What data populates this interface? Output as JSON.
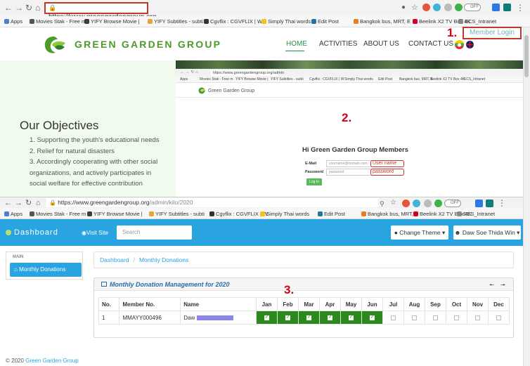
{
  "browser_top": {
    "url": "https://www.greengardengroup.org",
    "off_label": "OFF",
    "bookmarks": [
      {
        "label": "Apps",
        "color": "#4a7fd4"
      },
      {
        "label": "Movies Stak - Free m",
        "color": "#555555"
      },
      {
        "label": "YIFY Browse Movie |",
        "color": "#3c3c3c"
      },
      {
        "label": "YIFY Subtitles - subti",
        "color": "#e8a33d"
      },
      {
        "label": "Cgvflix : CGVFLIX | W",
        "color": "#333333"
      },
      {
        "label": "Simply Thai words",
        "color": "#f0c419"
      },
      {
        "label": "Edit Post",
        "color": "#21759b"
      },
      {
        "label": "Bangkok bus, MRT, E",
        "color": "#e67e22"
      },
      {
        "label": "Beelink X2 TV Box 4K",
        "color": "#d0021b"
      },
      {
        "label": "ECS_Intranet",
        "color": "#888888"
      }
    ]
  },
  "site": {
    "logo_text": "GREEN GARDEN GROUP",
    "menu": [
      "HOME",
      "ACTIVITIES",
      "ABOUT US",
      "CONTACT US"
    ],
    "member_login": "Member Login",
    "objectives_title": "Our Objectives",
    "objectives": [
      "1. Supporting the youth's educational needs",
      "2. Relief for natural disasters",
      "3. Accordingly cooperating with other social",
      "organizations, and actively participates in",
      "social welfare for effective contribution"
    ]
  },
  "steps": {
    "one": "1.",
    "two": "2.",
    "three": "3."
  },
  "login_shot": {
    "url": "https://www.greengardengroup.org/admin",
    "bookmarks": [
      "Apps",
      "Movies Stak - Free m",
      "YIFY Browse Movie |",
      "YIFY Subtitles - subti",
      "Cgvflix : CGVFLIX | W",
      "Simply Thai words",
      "Edit Post",
      "Bangkok bus, MRT, E",
      "Beelink X2 TV Box 4K",
      "ECS_Intranet"
    ],
    "logo_text": "Green Garden Group",
    "title": "Hi Green Garden Group Members",
    "email_label": "E-Mail",
    "email_placeholder": "yourname@domain.com",
    "password_label": "Password",
    "password_placeholder": "password",
    "username_hint": "User name",
    "password_hint": "password",
    "login_button": "Log In"
  },
  "browser_second": {
    "url_host": "https://www.greengardengroup.org",
    "url_path": "/admin/kilo/2020",
    "off_label": "OFF"
  },
  "dashboard": {
    "brand": "Dashboard",
    "visit_site": "Visit Site",
    "search_placeholder": "Search",
    "change_theme": "Change Theme ▾",
    "user": "Daw Soe Thida Win ▾",
    "sidebar_main": "MAIN",
    "sidebar_item": "Monthly Donations",
    "breadcrumb": [
      "Dashboard",
      "Monthly Donations"
    ],
    "panel_title": "Monthly Donation Management for 2020",
    "table": {
      "headers": [
        "No.",
        "Member No.",
        "Name",
        "Jan",
        "Feb",
        "Mar",
        "Apr",
        "May",
        "Jun",
        "Jul",
        "Aug",
        "Sep",
        "Oct",
        "Nov",
        "Dec"
      ],
      "rows": [
        {
          "no": "1",
          "member_no": "MMAYY000496",
          "name": "Daw",
          "paid": [
            true,
            true,
            true,
            true,
            true,
            true,
            false,
            false,
            false,
            false,
            false,
            false
          ]
        }
      ]
    },
    "footer_prefix": "© 2020 ",
    "footer_link": "Green Garden Group"
  },
  "colors": {
    "primary": "#2aa4e0",
    "paid": "#2a8a1d",
    "alert_red": "#c0392b",
    "brand_green": "#4c9a2a"
  }
}
